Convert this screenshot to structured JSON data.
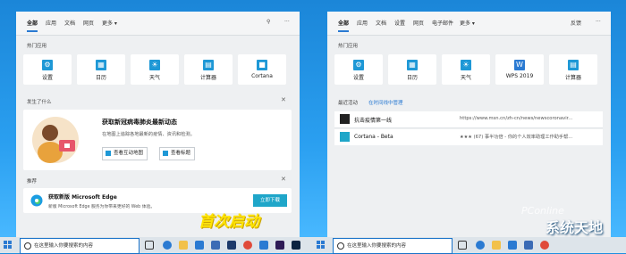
{
  "left": {
    "tabs": [
      "全部",
      "应用",
      "文档",
      "网页",
      "更多 ▾"
    ],
    "hot_apps_title": "热门应用",
    "tiles": [
      {
        "icon": "gear-icon",
        "label": "设置",
        "glyph": "⚙"
      },
      {
        "icon": "calendar-icon",
        "label": "日历",
        "glyph": "▦"
      },
      {
        "icon": "weather-icon",
        "label": "天气",
        "glyph": "☀"
      },
      {
        "icon": "calculator-icon",
        "label": "计算器",
        "glyph": "▤"
      },
      {
        "icon": "cortana-icon",
        "label": "Cortana",
        "glyph": "■"
      }
    ],
    "news": {
      "section": "发生了什么",
      "title": "获取新冠病毒肺炎最新动态",
      "desc": "在地图上追踪各地最新的疫情、资讯和检测。",
      "btn1": "查看互动地图",
      "btn2": "查看标题"
    },
    "recommend": {
      "section": "推荐",
      "title": "获取新版 Microsoft Edge",
      "desc": "新版 Microsoft Edge 服务为你带来更好的 Web 体验。",
      "button": "立即下载"
    },
    "search_placeholder": "在这里输入你要搜索的内容"
  },
  "right": {
    "tabs": [
      "全部",
      "应用",
      "文档",
      "设置",
      "网页",
      "电子邮件",
      "更多 ▾"
    ],
    "feedback": "反馈",
    "hot_apps_title": "热门应用",
    "tiles": [
      {
        "icon": "gear-icon",
        "label": "设置",
        "glyph": "⚙"
      },
      {
        "icon": "calendar-icon",
        "label": "日历",
        "glyph": "▦"
      },
      {
        "icon": "weather-icon",
        "label": "天气",
        "glyph": "☀"
      },
      {
        "icon": "wps-icon",
        "label": "WPS 2019",
        "glyph": "W"
      },
      {
        "icon": "calculator-icon",
        "label": "计算器",
        "glyph": "▤"
      }
    ],
    "recent_label": "最近活动",
    "manage_link": "在时间线中管理",
    "recent": [
      {
        "title": "抗击疫情第一线",
        "url": "https://www.msn.cn/zh-cn/news/newscoronavir..."
      },
      {
        "title": "Cortana - Beta",
        "url": "★★★ (67) 事半功倍 - 你的个人效率助理工作助手帮..."
      }
    ],
    "search_placeholder": "在这里输入你要搜索的内容"
  },
  "overlay": {
    "promo": "首次启动",
    "watermark": "系统天地",
    "pconline": "PConline"
  },
  "colors": {
    "accent": "#2a7ad2",
    "tile_icon": "#1e98d6",
    "download": "#1fa6c9",
    "promo": "#ffe400"
  }
}
